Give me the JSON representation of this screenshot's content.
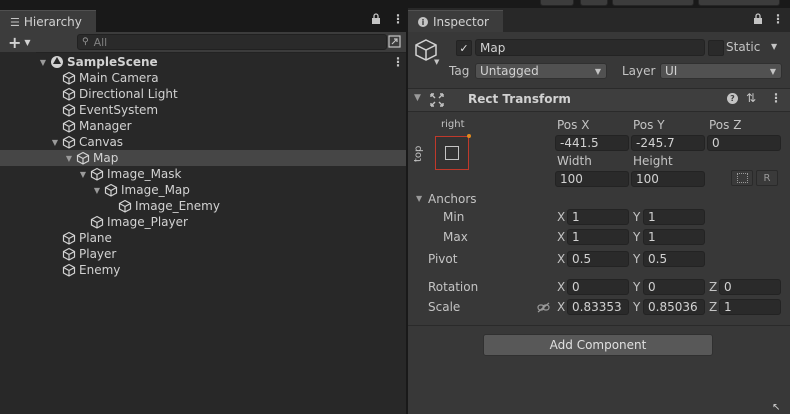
{
  "hierarchy": {
    "tab_label": "Hierarchy",
    "add_label": "+",
    "search_placeholder": "All",
    "scene_name": "SampleScene",
    "items": [
      {
        "label": "Main Camera"
      },
      {
        "label": "Directional Light"
      },
      {
        "label": "EventSystem"
      },
      {
        "label": "Manager"
      },
      {
        "label": "Canvas"
      },
      {
        "label": "Map"
      },
      {
        "label": "Image_Mask"
      },
      {
        "label": "Image_Map"
      },
      {
        "label": "Image_Enemy"
      },
      {
        "label": "Image_Player"
      },
      {
        "label": "Plane"
      },
      {
        "label": "Player"
      },
      {
        "label": "Enemy"
      }
    ]
  },
  "inspector": {
    "tab_label": "Inspector",
    "object_name": "Map",
    "static_label": "Static",
    "tag_label": "Tag",
    "tag_value": "Untagged",
    "layer_label": "Layer",
    "layer_value": "UI",
    "component_title": "Rect Transform",
    "anchor_preset": {
      "h": "right",
      "v": "top"
    },
    "pos_x_label": "Pos X",
    "pos_y_label": "Pos Y",
    "pos_z_label": "Pos Z",
    "pos_x": "-441.5",
    "pos_y": "-245.7",
    "pos_z": "0",
    "width_label": "Width",
    "height_label": "Height",
    "width": "100",
    "height": "100",
    "r_button": "R",
    "anchors_label": "Anchors",
    "min_label": "Min",
    "max_label": "Max",
    "x_label": "X",
    "y_label": "Y",
    "z_label": "Z",
    "min_x": "1",
    "min_y": "1",
    "max_x": "1",
    "max_y": "1",
    "pivot_label": "Pivot",
    "pivot_x": "0.5",
    "pivot_y": "0.5",
    "rotation_label": "Rotation",
    "rot_x": "0",
    "rot_y": "0",
    "rot_z": "0",
    "scale_label": "Scale",
    "scale_x": "0.83353",
    "scale_y": "0.85036",
    "scale_z": "1",
    "add_component": "Add Component"
  },
  "colors": {
    "selection": "#464646",
    "anchor_accent": "#c0392b"
  }
}
